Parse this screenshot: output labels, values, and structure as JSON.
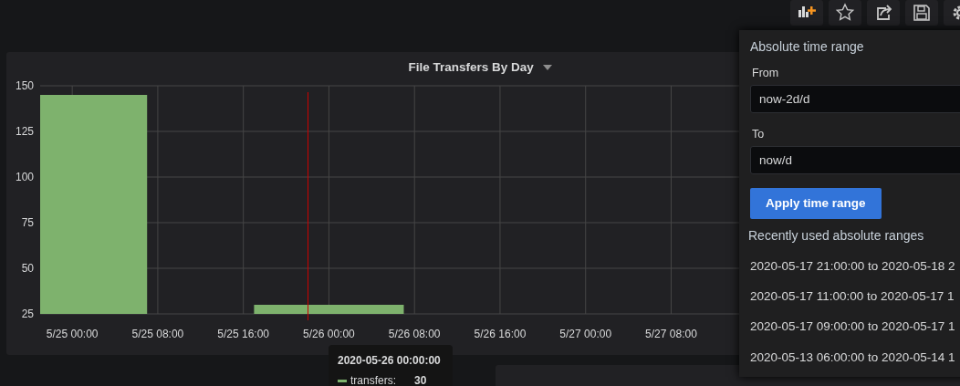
{
  "toolbar": [
    {
      "kind": "add-panel"
    },
    {
      "kind": "star"
    },
    {
      "kind": "share"
    },
    {
      "kind": "save"
    },
    {
      "kind": "settings"
    }
  ],
  "panel": {
    "title": "File Transfers By Day",
    "chart_data": {
      "type": "bar",
      "categories": [
        "5/25 00:00",
        "5/25 08:00",
        "5/25 16:00",
        "5/26 00:00",
        "5/26 08:00",
        "5/26 16:00",
        "5/27 00:00",
        "5/27 08:00"
      ],
      "series": [
        {
          "color": "#7eb26d",
          "values": [
            145,
            null,
            null,
            30,
            null,
            null,
            null,
            null
          ]
        }
      ],
      "grid": true,
      "ylim": [
        25,
        150
      ],
      "yticks": [
        25,
        50,
        75,
        100,
        125,
        150
      ]
    }
  },
  "tooltip": {
    "title": "2020-05-26 00:00:00",
    "series": "transfers:",
    "value": "30",
    "color": "#7eb26d"
  },
  "time_picker": {
    "title": "Absolute time range",
    "from": {
      "label": "From",
      "value": "now-2d/d"
    },
    "to": {
      "label": "To",
      "value": "now/d"
    },
    "apply": "Apply time range",
    "recent_title": "Recently used absolute ranges",
    "recent": [
      "2020-05-17 21:00:00 to 2020-05-18 2",
      "2020-05-17 11:00:00 to 2020-05-17 1",
      "2020-05-17 09:00:00 to 2020-05-17 1",
      "2020-05-13 06:00:00 to 2020-05-14 1"
    ]
  }
}
